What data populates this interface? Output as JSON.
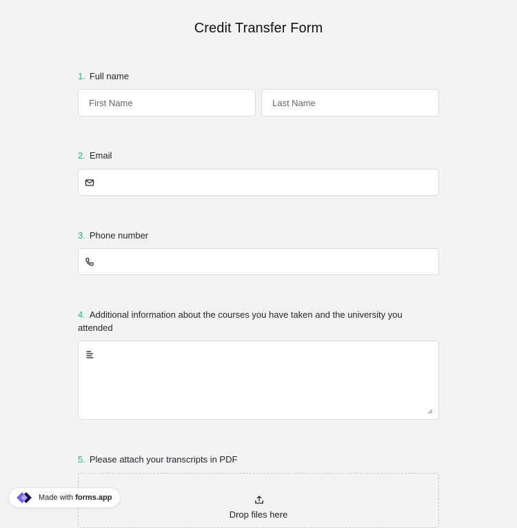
{
  "form": {
    "title": "Credit Transfer Form"
  },
  "questions": [
    {
      "number": "1.",
      "label": "Full name"
    },
    {
      "number": "2.",
      "label": "Email"
    },
    {
      "number": "3.",
      "label": "Phone number"
    },
    {
      "number": "4.",
      "label": "Additional information about the courses you have taken and the university you attended"
    },
    {
      "number": "5.",
      "label": "Please attach your transcripts in PDF"
    }
  ],
  "fields": {
    "first_name_placeholder": "First Name",
    "last_name_placeholder": "Last Name",
    "email_icon": "envelope-icon",
    "phone_icon": "phone-icon",
    "textarea_icon": "text-align-left-icon"
  },
  "upload": {
    "icon": "upload-icon",
    "text": "Drop files here"
  },
  "badge": {
    "prefix": "Made with",
    "brand": "forms.app"
  },
  "colors": {
    "accent": "#20b58a",
    "background": "#f3f3f3",
    "field_bg": "#ffffff",
    "logo_purple": "#6a4cf5"
  }
}
